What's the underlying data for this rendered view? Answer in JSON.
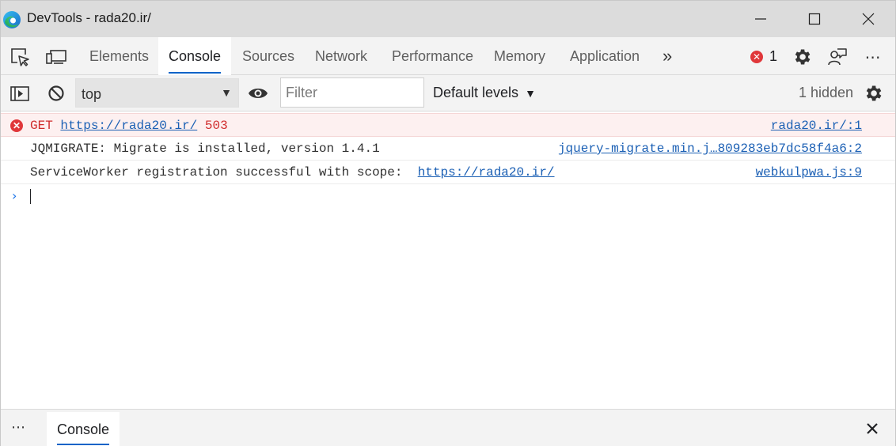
{
  "window": {
    "title": "DevTools - rada20.ir/"
  },
  "tabs": [
    {
      "label": "Elements"
    },
    {
      "label": "Console"
    },
    {
      "label": "Sources"
    },
    {
      "label": "Network"
    },
    {
      "label": "Performance"
    },
    {
      "label": "Memory"
    },
    {
      "label": "Application"
    }
  ],
  "overflow_label": "»",
  "error_count": "1",
  "toolbar": {
    "context": "top",
    "filter_placeholder": "Filter",
    "levels_label": "Default levels",
    "hidden_label": "1 hidden"
  },
  "messages": [
    {
      "type": "error",
      "method": "GET",
      "url": "https://rada20.ir/",
      "status": "503",
      "source": "rada20.ir/:1"
    },
    {
      "type": "log",
      "text": "JQMIGRATE: Migrate is installed, version 1.4.1",
      "source": "jquery-migrate.min.j…809283eb7dc58f4a6:2"
    },
    {
      "type": "log",
      "text": "ServiceWorker registration successful with scope:",
      "url": "https://rada20.ir/",
      "source": "webkulpwa.js:9"
    }
  ],
  "drawer": {
    "more_label": "⋯",
    "tab_label": "Console"
  },
  "colors": {
    "accent": "#0a64c8",
    "error": "#e0373a",
    "link": "#1a5fb4"
  }
}
